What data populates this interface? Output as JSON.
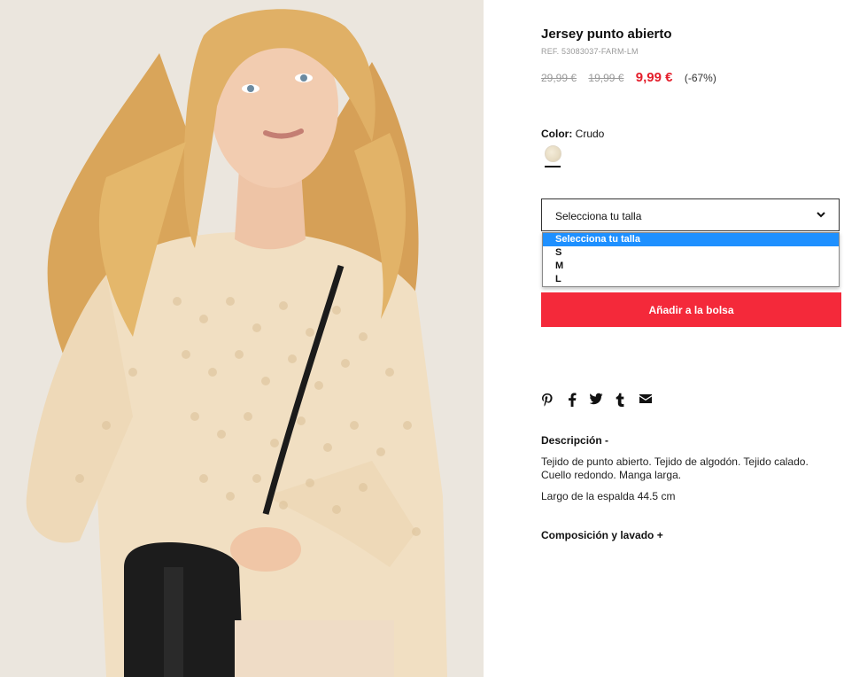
{
  "product": {
    "name": "Jersey punto abierto",
    "ref": "REF. 53083037-FARM-LM",
    "old_price_1": "29,99 €",
    "old_price_2": "19,99 €",
    "price": "9,99 €",
    "discount": "(-67%)"
  },
  "color": {
    "label": "Color:",
    "value": "Crudo",
    "swatch": "#efe5cf"
  },
  "size_select": {
    "selected": "Selecciona tu talla",
    "options": [
      "Selecciona tu talla",
      "S",
      "M",
      "L"
    ]
  },
  "cart": {
    "add_label": "Añadir a la bolsa",
    "color": "#f4293a"
  },
  "share": {
    "icons": [
      "pinterest-icon",
      "facebook-icon",
      "twitter-icon",
      "tumblr-icon",
      "email-icon"
    ]
  },
  "description": {
    "heading": "Descripción -",
    "text": "Tejido de punto abierto. Tejido de algodón. Tejido calado. Cuello redondo. Manga larga.",
    "length": "Largo de la espalda 44.5 cm"
  },
  "composition": {
    "heading": "Composición y lavado +"
  },
  "colors": {
    "sale_red": "#e41e2b",
    "highlight_blue": "#1e90ff"
  }
}
